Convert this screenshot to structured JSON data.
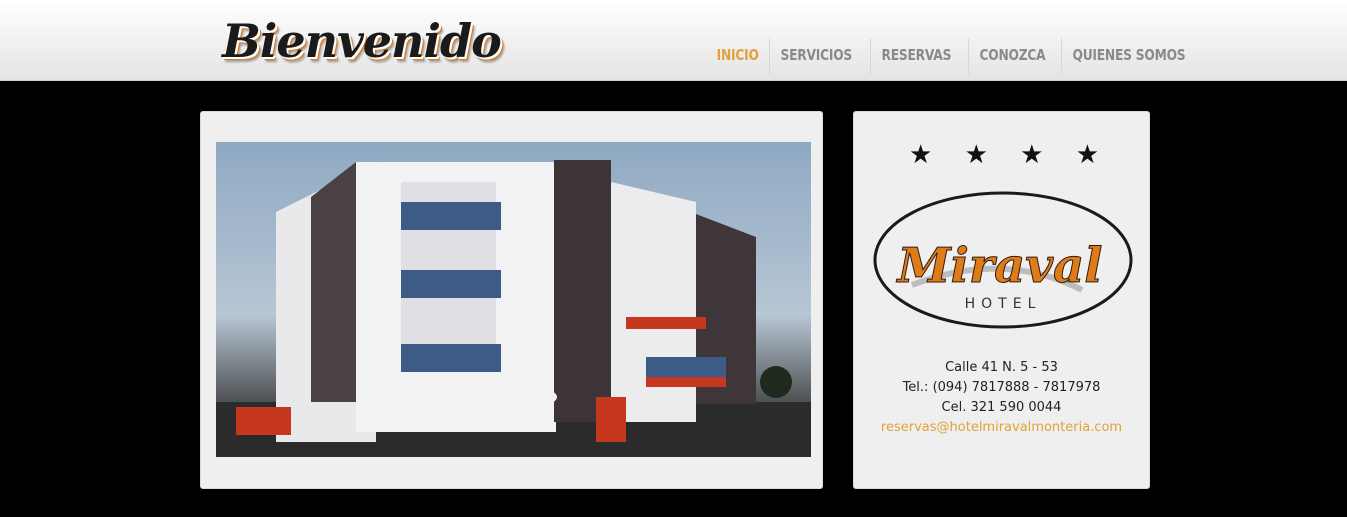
{
  "header": {
    "logo_text": "Bienvenido",
    "nav": [
      {
        "label": "INICIO",
        "active": true
      },
      {
        "label": "SERVICIOS",
        "active": false
      },
      {
        "label": "RESERVAS",
        "active": false
      },
      {
        "label": "CONOZCA",
        "active": false
      },
      {
        "label": "QUIENES SOMOS",
        "active": false
      }
    ]
  },
  "sidebar": {
    "stars": [
      "★",
      "★",
      "★",
      "★"
    ],
    "hotel_logo": {
      "name": "Miraval",
      "subtitle": "HOTEL"
    },
    "address": "Calle 41 N. 5 - 53",
    "phone": "Tel.: (094) 7817888 - 7817978",
    "cell": "Cel. 321 590 0044",
    "email": "reservas@hotelmiravalmonteria.com"
  },
  "colors": {
    "accent": "#e2a13a",
    "nav_text": "#8a8a8a",
    "background": "#000000",
    "panel": "#efefef",
    "logo_orange": "#e07b1a"
  }
}
